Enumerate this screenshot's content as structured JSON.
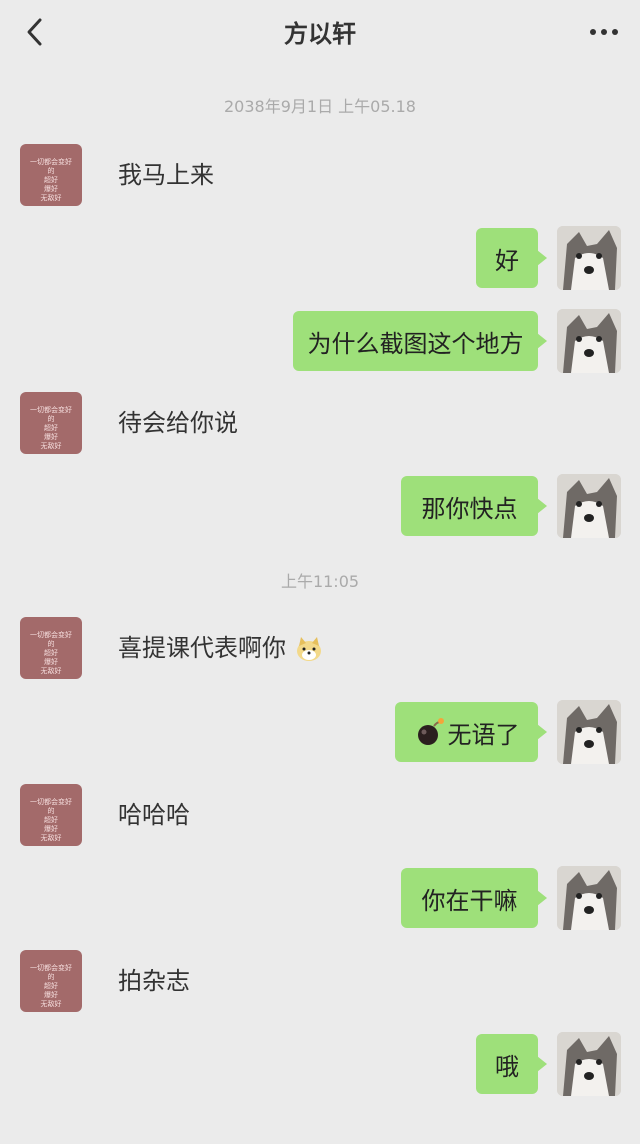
{
  "header": {
    "title": "方以轩",
    "back_icon": "chevron-left-icon",
    "more_icon": "ellipsis-icon"
  },
  "timestamps": {
    "first": "2038年9月1日 上午05.18",
    "second": "上午11:05"
  },
  "avatar_left": {
    "lines": [
      "一切都会变好的",
      "超好",
      "爆好",
      "无敌好"
    ]
  },
  "messages": [
    {
      "side": "left",
      "text": "我马上来"
    },
    {
      "side": "right",
      "text": "好"
    },
    {
      "side": "right",
      "text": "为什么截图这个地方"
    },
    {
      "side": "left",
      "text": "待会给你说"
    },
    {
      "side": "right",
      "text": "那你快点"
    },
    {
      "side": "left",
      "text": "喜提课代表啊你",
      "emoji": "doge-emoji"
    },
    {
      "side": "right",
      "text": "无语了",
      "emoji": "bomb-emoji"
    },
    {
      "side": "left",
      "text": "哈哈哈"
    },
    {
      "side": "right",
      "text": "你在干嘛"
    },
    {
      "side": "left",
      "text": "拍杂志"
    },
    {
      "side": "right",
      "text": "哦"
    }
  ],
  "colors": {
    "background": "#ebebeb",
    "bubble_right": "#9ee07a",
    "avatar_left": "#a36a6a"
  }
}
